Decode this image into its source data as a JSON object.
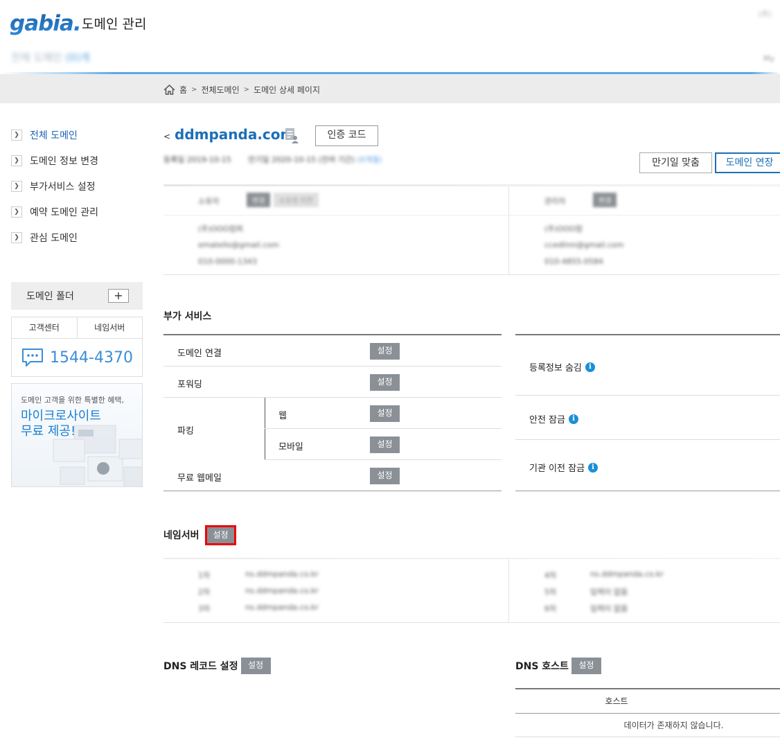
{
  "header": {
    "logo_text": "gabia.",
    "app_title": "도메인 관리",
    "top_right": "(주)",
    "sub_title": "전체 도메인",
    "sub_title_hl": "(0)개",
    "top_right2": "My"
  },
  "breadcrumb": {
    "home": "홈",
    "sep": ">",
    "level1": "전체도메인",
    "level2": "도메인 상세 페이지"
  },
  "sidebar": {
    "items": [
      {
        "label": "전체 도메인",
        "active": true
      },
      {
        "label": "도메인 정보 변경"
      },
      {
        "label": "부가서비스 설정"
      },
      {
        "label": "예약 도메인 관리"
      },
      {
        "label": "관심 도메인"
      }
    ],
    "folder_label": "도메인 폴더",
    "folder_add": "+",
    "cs_tabs": [
      "고객센터",
      "네임서버"
    ],
    "cs_phone": "1544-4370",
    "promo_line1": "도메인 고객을 위한 특별한 혜택,",
    "promo_line2": "마이크로사이트 무료 제공!"
  },
  "domain": {
    "back": "<",
    "name": "ddmpanda.com",
    "auth_code_button": "인증 코드",
    "reg_info": "등록일 2019-10-15",
    "expire_info": "만기일 2020-10-15 (잔여 기간)",
    "expire_hl": "(0개월)",
    "expire_match_button": "만기일 맞춤",
    "renew_button": "도메인 연장"
  },
  "contacts": {
    "owner_label": "소유자",
    "owner_btn": "변경",
    "owner_btn2": "소유권 이전",
    "owner_lines": [
      "(주)OOO컴퍼",
      "ematello@gmail.com",
      "010-0000-1343"
    ],
    "admin_label": "관리자",
    "admin_btn": "변경",
    "admin_lines": [
      "(주)OOO컴",
      "ccedlinn@gmail.com",
      "010-4855-0584"
    ]
  },
  "services": {
    "title": "부가 서비스",
    "set_label": "설정",
    "domain_link": "도메인 연결",
    "forwarding": "포워딩",
    "parking": "파킹",
    "web": "웹",
    "mobile": "모바일",
    "webmail": "무료 웹메일",
    "reg_hide": "등록정보 숨김",
    "safe_lock": "안전 잠금",
    "transfer_lock": "기관 이전 잠금",
    "info_glyph": "i"
  },
  "nameserver": {
    "title": "네임서버",
    "set_label": "설정",
    "left_rows": [
      {
        "k": "1차",
        "v": "ns.ddmpanda.co.kr"
      },
      {
        "k": "2차",
        "v": "ns.ddmpanda.co.kr"
      },
      {
        "k": "3차",
        "v": "ns.ddmpanda.co.kr"
      }
    ],
    "right_rows": [
      {
        "k": "4차",
        "v": "ns.ddmpanda.co.kr"
      },
      {
        "k": "5차",
        "v": "입력이 없음"
      },
      {
        "k": "6차",
        "v": "입력이 없음"
      }
    ]
  },
  "dns": {
    "record_title": "DNS 레코드 설정",
    "host_title": "DNS 호스트",
    "set_label": "설정",
    "host_col": "호스트",
    "empty_msg": "데이터가 존재하지 않습니다."
  }
}
